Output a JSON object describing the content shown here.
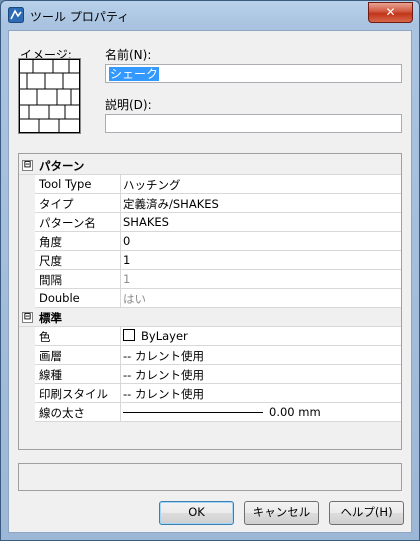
{
  "window": {
    "title": "ツール プロパティ",
    "close_label": "✕"
  },
  "form": {
    "image_label": "イメージ:",
    "name_label": "名前(N):",
    "name_value": "シェーク",
    "description_label": "説明(D):",
    "description_value": ""
  },
  "grid": {
    "pattern": {
      "title": "パターン",
      "toggle": "⊟",
      "rows": [
        {
          "key": "Tool Type",
          "value": "ハッチング"
        },
        {
          "key": "タイプ",
          "value": "定義済み/SHAKES"
        },
        {
          "key": "パターン名",
          "value": "SHAKES"
        },
        {
          "key": "角度",
          "value": "0"
        },
        {
          "key": "尺度",
          "value": "1"
        },
        {
          "key": "間隔",
          "value": "1"
        },
        {
          "key": "Double",
          "value": "はい"
        }
      ]
    },
    "general": {
      "title": "標準",
      "toggle": "⊟",
      "rows": [
        {
          "key": "色",
          "value": "ByLayer"
        },
        {
          "key": "画層",
          "value": "-- カレント使用"
        },
        {
          "key": "線種",
          "value": "-- カレント使用"
        },
        {
          "key": "印刷スタイル",
          "value": "-- カレント使用"
        },
        {
          "key": "線の太さ",
          "value": "0.00 mm"
        }
      ]
    }
  },
  "buttons": {
    "ok": "OK",
    "cancel": "キャンセル",
    "help": "ヘルプ(H)"
  },
  "colors": {
    "selection": "#3399ff",
    "titlebar": "#b9d1ea",
    "close": "#c23418"
  }
}
